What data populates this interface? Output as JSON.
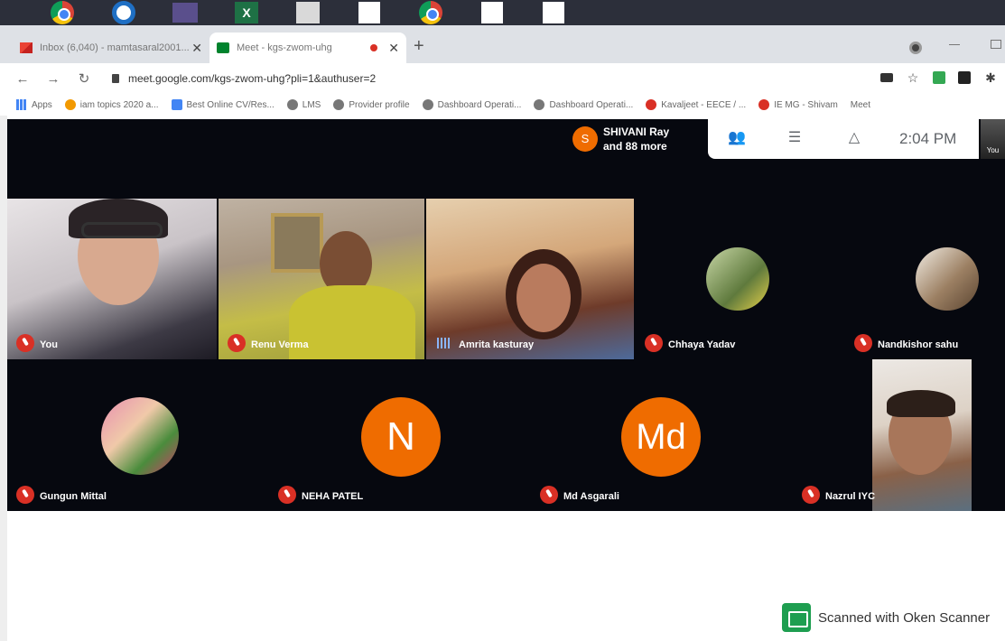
{
  "browser": {
    "tabs": [
      {
        "title": "Inbox (6,040) - mamtasaral2001...",
        "active": false
      },
      {
        "title": "Meet - kgs-zwom-uhg",
        "active": true
      }
    ],
    "url": "meet.google.com/kgs-zwom-uhg?pli=1&authuser=2",
    "bookmarks": [
      {
        "label": "Apps",
        "icon": "apps-grid-icon"
      },
      {
        "label": "iam topics 2020 a...",
        "icon": "bookmark-icon"
      },
      {
        "label": "Best Online CV/Res...",
        "icon": "doc-icon"
      },
      {
        "label": "LMS",
        "icon": "globe-icon"
      },
      {
        "label": "Provider profile",
        "icon": "globe-icon"
      },
      {
        "label": "Dashboard Operati...",
        "icon": "globe-icon"
      },
      {
        "label": "Dashboard Operati...",
        "icon": "globe-icon"
      },
      {
        "label": "Kavaljeet - EECE / ...",
        "icon": "pin-icon"
      },
      {
        "label": "IE MG - Shivam",
        "icon": "pin-icon"
      },
      {
        "label": "Meet",
        "icon": "meet-icon"
      }
    ]
  },
  "meet": {
    "presenter": {
      "initial": "S",
      "line1": "SHIVANI Ray",
      "line2": "and 88 more"
    },
    "time": "2:04 PM",
    "self_thumb_label": "You",
    "participants": [
      {
        "name": "You",
        "type": "video",
        "muted": true
      },
      {
        "name": "Renu Verma",
        "type": "video",
        "muted": true
      },
      {
        "name": "Amrita kasturay",
        "type": "video",
        "muted": false
      },
      {
        "name": "Chhaya Yadav",
        "type": "photo",
        "muted": true
      },
      {
        "name": "Nandkishor sahu",
        "type": "photo",
        "muted": true
      },
      {
        "name": "Gungun Mittal",
        "type": "photo",
        "muted": true
      },
      {
        "name": "NEHA PATEL",
        "type": "letter",
        "letter": "N",
        "muted": true
      },
      {
        "name": "Md Asgarali",
        "type": "letter",
        "letter": "Md",
        "muted": true
      },
      {
        "name": "Nazrul IYC",
        "type": "video",
        "muted": true
      }
    ]
  },
  "watermark": "Scanned with Oken Scanner",
  "colors": {
    "avatar_orange": "#ef6c00",
    "mic_red": "#d93025",
    "meet_bg": "#06080f"
  }
}
